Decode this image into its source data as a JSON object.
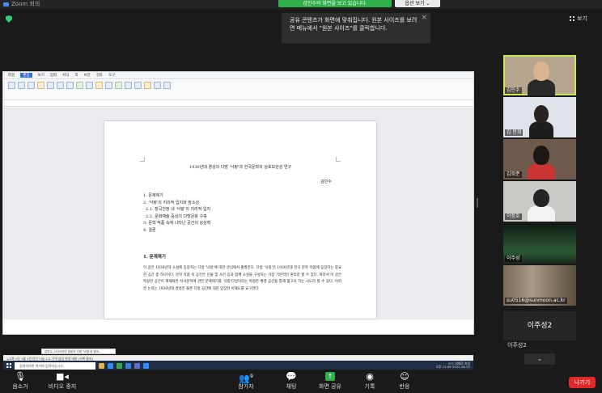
{
  "window": {
    "title": "Zoom 회의"
  },
  "banner": {
    "text": "김민수의 화면을 보고 있습니다.",
    "view_option": "옵션 보기 ⌄"
  },
  "toast": {
    "message": "공유 콘텐츠가 화면에 맞춰집니다. 원본 사이즈를 보려면 메뉴에서 \"원본 사이즈\"를 클릭합니다.",
    "close": "×"
  },
  "gallery": {
    "label": "보기"
  },
  "shared_screen": {
    "menus": [
      "파일",
      "편집",
      "보기",
      "입력",
      "서식",
      "쪽",
      "보안",
      "검토",
      "도구"
    ],
    "active_menu": "편집",
    "document": {
      "title": "1930년대 경성의 다방 '낙랑'과 한국문학의 상호보완성 연구",
      "author": "김민수",
      "toc": [
        "1. 문제제기",
        "2. '낙랑'의 지리적 입지와 장소성",
        "  2.1. 장곡천정 내 '낙랑'의 지리적 입지",
        "  2.2. 문화예술 중심의 다방문화 구축",
        "3. 문학 작품 속에 나타난 공간의 상상력",
        "4. 결론"
      ],
      "section_heading": "1. 문제제기",
      "body": "이 글은 1930년대 소설에 등장하는 다방 '낙랑'에 대한 관심에서 출발한다. 다방 '낙랑'은 1930년대 한국 문학 작품에 등장하는 중요한 공간 중 하나이다. 문학 작품 속 공간은 인물 및 사건 등과 함께 소설을 구성하는 가장 기본적인 원리라 할 수 있다. 따라서 이 글은 특정한 공간이 제재화된 서사문학에 관한 문제제기를 '낙랑'다방이라는 특정한 배경 공간을 통해 풀고자 하는 시도라 할 수 있다. 이러한 논의는 1930년대 경성은 물론 다방 공간에 대한 입장한 이해도를 요구한다."
    },
    "doc_tab": "김민수_1930년대 경성의 다방 '낙랑'과 한국...",
    "status": "1/1쪽   1단   1줄   1칸   문단 나눔   1/1 구역   삽입   변경 내용 [기록 중지]",
    "taskbar": {
      "search_placeholder": "검색하려면 여기에 입력하십시오.",
      "weather": "0°C 대체로 흐림",
      "time": "오후 11:06",
      "date": "2021-08-22"
    }
  },
  "participants": [
    {
      "name": "김민수",
      "active": true
    },
    {
      "name": "김 한희",
      "active": false
    },
    {
      "name": "김희준",
      "active": false
    },
    {
      "name": "이정호",
      "active": false
    },
    {
      "name": "이주성",
      "active": false
    },
    {
      "name": "su0516@sunmoon.ac.kr",
      "active": false
    }
  ],
  "featured": {
    "name": "이주성2",
    "caption": "이주성2"
  },
  "scroll": {
    "label": "⌄"
  },
  "toolbar": {
    "mute": "음소거",
    "video": "비디오 중지",
    "participants": "참가자",
    "participants_count": "9",
    "chat": "채팅",
    "share": "화면 공유",
    "record": "기록",
    "reactions": "반응",
    "leave": "나가기"
  },
  "colors": {
    "share_green": "#2fb04a",
    "leave_red": "#e02828",
    "active_outline": "#c8e65b"
  }
}
